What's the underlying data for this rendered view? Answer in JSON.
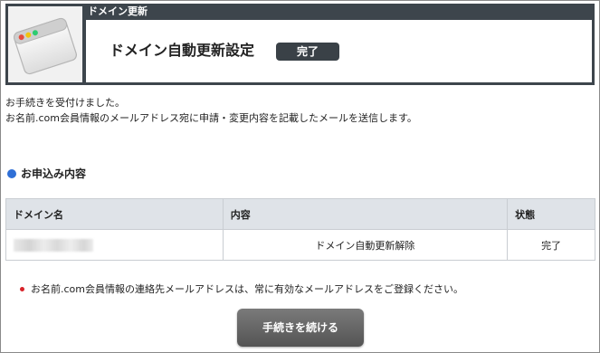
{
  "header": {
    "label": "ドメイン更新",
    "title": "ドメイン自動更新設定",
    "status": "完了",
    "icon": "browser-window-icon"
  },
  "messages": [
    "お手続きを受付けました。",
    "お名前.com会員情報のメールアドレス宛に申請・変更内容を記載したメールを送信します。"
  ],
  "section": {
    "title": "お申込み内容",
    "bullet_color": "#2f6fd6"
  },
  "table": {
    "headers": [
      "ドメイン名",
      "内容",
      "状態"
    ],
    "rows": [
      {
        "content": "ドメイン自動更新解除",
        "status": "完了"
      }
    ]
  },
  "note": "お名前.com会員情報の連絡先メールアドレスは、常に有効なメールアドレスをご登録ください。",
  "button": {
    "continue_label": "手続きを続ける"
  }
}
